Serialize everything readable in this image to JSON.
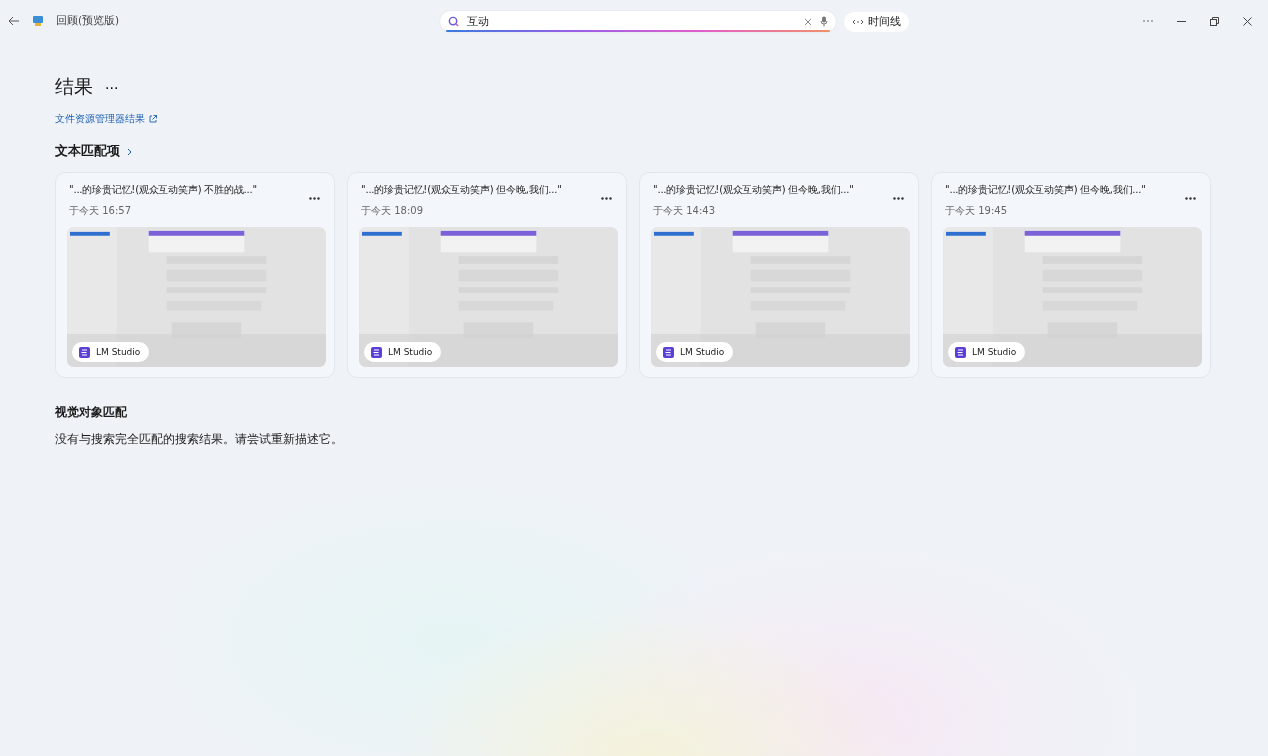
{
  "window": {
    "title": "回顾(预览版)"
  },
  "search": {
    "value": "互动",
    "timeline_button": "时间线"
  },
  "results": {
    "heading": "结果",
    "more": "...",
    "explorer_link": "文件资源管理器结果"
  },
  "text_matches": {
    "heading": "文本匹配项",
    "cards": [
      {
        "snippet": "\"...的珍贵记忆!(观众互动笑声) 不胜的战...\"",
        "time": "于今天 16:57",
        "app": "LM Studio"
      },
      {
        "snippet": "\"...的珍贵记忆!(观众互动笑声) 但今晚,我们...\"",
        "time": "于今天 18:09",
        "app": "LM Studio"
      },
      {
        "snippet": "\"...的珍贵记忆!(观众互动笑声) 但今晚,我们...\"",
        "time": "于今天 14:43",
        "app": "LM Studio"
      },
      {
        "snippet": "\"...的珍贵记忆!(观众互动笑声) 但今晚,我们...\"",
        "time": "于今天 19:45",
        "app": "LM Studio"
      }
    ]
  },
  "visual_matches": {
    "heading": "视觉对象匹配",
    "message": "没有与搜索完全匹配的搜索结果。请尝试重新描述它。"
  }
}
